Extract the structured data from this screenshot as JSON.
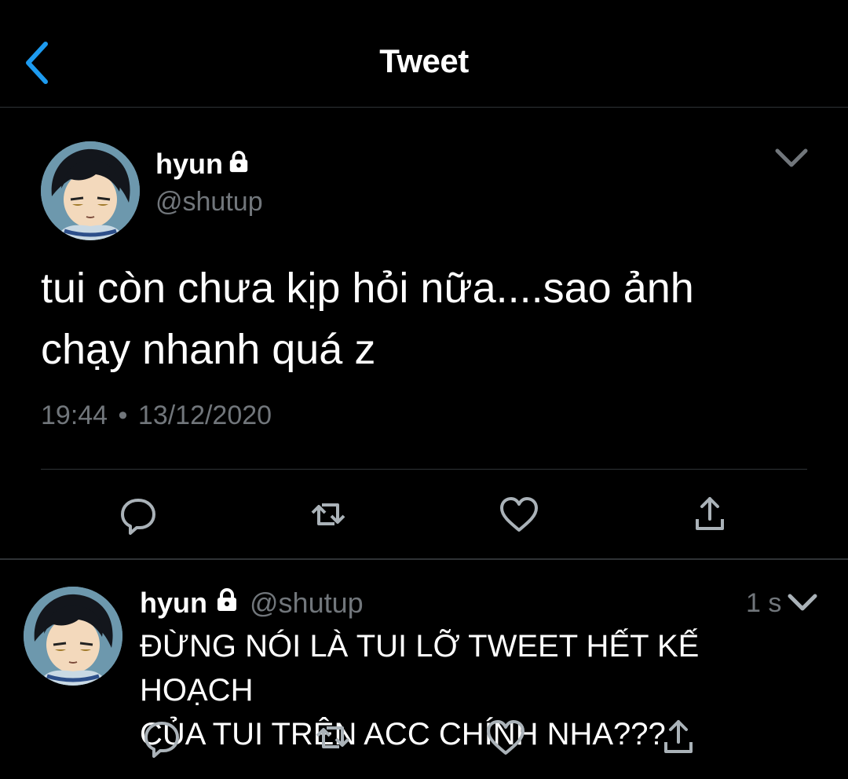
{
  "header": {
    "title": "Tweet",
    "back_icon": "chevron-left-icon",
    "accent_color": "#1d9bf0"
  },
  "main_tweet": {
    "display_name": "hyun",
    "handle": "@shutup",
    "text_line1": "tui còn chưa kịp hỏi nữa....sao ảnh",
    "text_line2": "chạy nhanh quá z",
    "time": "19:44",
    "separator": "•",
    "date": "13/12/2020",
    "protected_icon": "lock-icon",
    "menu_icon": "chevron-down-icon",
    "actions": [
      "reply-icon",
      "retweet-icon",
      "like-icon",
      "share-icon"
    ]
  },
  "reply_tweet": {
    "display_name": "hyun",
    "handle": "@shutup",
    "time": "1 s",
    "text_line1": "ĐỪNG NÓI LÀ TUI LỠ TWEET HẾT KẾ HOẠCH",
    "text_line2": "CỦA TUI TRÊN ACC CHÍNH NHA???",
    "protected_icon": "lock-icon",
    "menu_icon": "chevron-down-icon",
    "actions": [
      "reply-icon",
      "retweet-icon",
      "like-icon",
      "share-icon"
    ]
  },
  "colors": {
    "background": "#000000",
    "text_primary": "#ffffff",
    "text_secondary": "#71767b",
    "divider": "#2f3336"
  }
}
